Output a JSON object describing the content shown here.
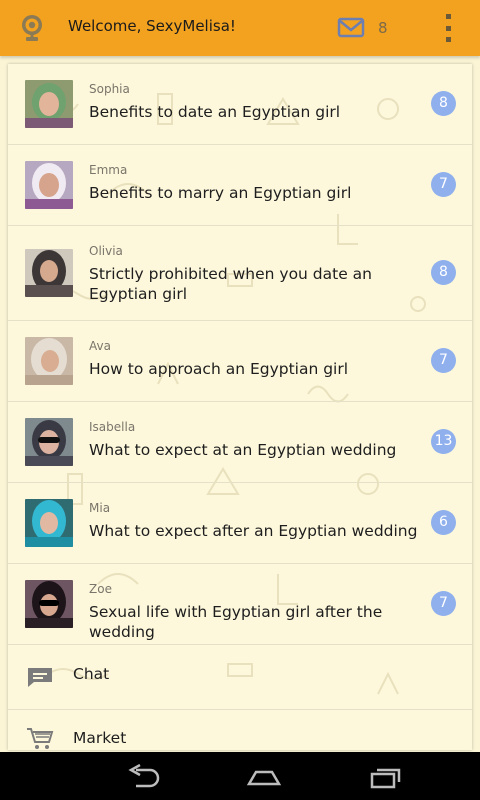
{
  "header": {
    "welcome": "Welcome, SexyMelisa!",
    "mail_count": "8",
    "logo_icon": "webcam-icon",
    "mail_icon": "envelope-icon",
    "menu_icon": "overflow-menu-icon"
  },
  "topics": [
    {
      "name": "Sophia",
      "title": "Benefits to date an Egyptian girl",
      "count": "8"
    },
    {
      "name": "Emma",
      "title": "Benefits to marry an Egyptian girl",
      "count": "7"
    },
    {
      "name": "Olivia",
      "title": "Strictly prohibited when you date an Egyptian girl",
      "count": "8"
    },
    {
      "name": "Ava",
      "title": "How to approach an Egyptian girl",
      "count": "7"
    },
    {
      "name": "Isabella",
      "title": "What to expect at an Egyptian wedding",
      "count": "13"
    },
    {
      "name": "Mia",
      "title": "What to expect after an Egyptian wedding",
      "count": "6"
    },
    {
      "name": "Zoe",
      "title": "Sexual life with Egyptian girl after the wedding",
      "count": "7"
    }
  ],
  "nav": {
    "chat": "Chat",
    "market": "Market"
  },
  "colors": {
    "appbar": "#f3a21f",
    "background": "#fdf8dc",
    "badge": "#8fb0ed"
  }
}
